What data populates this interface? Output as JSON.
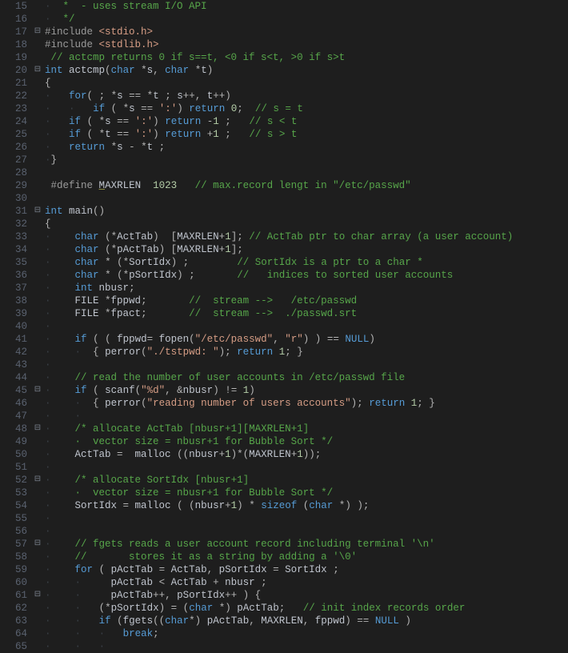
{
  "editor": {
    "first_line": 15,
    "fold_markers": {
      "20": "⊟",
      "29": " ",
      "31": "⊟",
      "45": "⊟",
      "48": "⊟",
      "52": "⊟",
      "57": "⊟",
      "61": "⊟",
      "18": " ",
      "17": "⊟"
    },
    "lines": [
      {
        "n": 15,
        "html": "<span class='guide'>·</span>  <span class='c-cmt'>*  - uses stream I/O API</span>"
      },
      {
        "n": 16,
        "html": "<span class='guide'>·</span>  <span class='c-cmt'>*/</span>"
      },
      {
        "n": 17,
        "html": "<span class='c-pp'>#include</span> <span class='c-str'>&lt;stdio.h&gt;</span>"
      },
      {
        "n": 18,
        "html": "<span class='c-pp'>#include</span> <span class='c-str'>&lt;stdlib.h&gt;</span>"
      },
      {
        "n": 19,
        "html": " <span class='c-cmt'>// actcmp returns 0 if s==t, &lt;0 if s&lt;t, &gt;0 if s&gt;t</span>"
      },
      {
        "n": 20,
        "html": "<span class='c-kw'>int</span> <span class='c-fn'>actcmp</span><span class='c-punc'>(</span><span class='c-kw'>char</span> <span class='c-op'>*</span>s<span class='c-punc'>,</span> <span class='c-kw'>char</span> <span class='c-op'>*</span>t<span class='c-punc'>)</span>"
      },
      {
        "n": 21,
        "html": "<span class='c-br'>{</span>"
      },
      {
        "n": 22,
        "html": "<span class='guide'>·</span>   <span class='c-kw'>for</span><span class='c-punc'>(</span> <span class='c-punc'>;</span> <span class='c-op'>*</span>s <span class='c-op'>==</span> <span class='c-op'>*</span>t <span class='c-punc'>;</span> s<span class='c-op'>++</span><span class='c-punc'>,</span> t<span class='c-op'>++</span><span class='c-punc'>)</span>"
      },
      {
        "n": 23,
        "html": "<span class='guide'>·</span>   <span class='guide'>·</span>   <span class='c-kw'>if</span> <span class='c-punc'>(</span> <span class='c-op'>*</span>s <span class='c-op'>==</span> <span class='c-str'>':'</span><span class='c-punc'>)</span> <span class='c-kw'>return</span> <span class='c-num'>0</span><span class='c-punc'>;</span>  <span class='c-cmt'>// s = t</span>"
      },
      {
        "n": 24,
        "html": "<span class='guide'>·</span>   <span class='c-kw'>if</span> <span class='c-punc'>(</span> <span class='c-op'>*</span>s <span class='c-op'>==</span> <span class='c-str'>':'</span><span class='c-punc'>)</span> <span class='c-kw'>return</span> <span class='c-op'>-</span><span class='c-num'>1</span> <span class='c-punc'>;</span>   <span class='c-cmt'>// s &lt; t</span>"
      },
      {
        "n": 25,
        "html": "<span class='guide'>·</span>   <span class='c-kw'>if</span> <span class='c-punc'>(</span> <span class='c-op'>*</span>t <span class='c-op'>==</span> <span class='c-str'>':'</span><span class='c-punc'>)</span> <span class='c-kw'>return</span> <span class='c-op'>+</span><span class='c-num'>1</span> <span class='c-punc'>;</span>   <span class='c-cmt'>// s &gt; t</span>"
      },
      {
        "n": 26,
        "html": "<span class='guide'>·</span>   <span class='c-kw'>return</span> <span class='c-op'>*</span>s <span class='c-op'>-</span> <span class='c-op'>*</span>t <span class='c-punc'>;</span>"
      },
      {
        "n": 27,
        "html": "<span class='guide'>·</span><span class='c-br'>}</span>"
      },
      {
        "n": 28,
        "html": ""
      },
      {
        "n": 29,
        "html": " <span class='c-pp'>#define</span> <span class='underline'>M</span>AXRLEN  <span class='c-num'>1023</span>   <span class='c-cmt'>// max.record lengt in \"/etc/passwd\"</span>"
      },
      {
        "n": 30,
        "html": ""
      },
      {
        "n": 31,
        "html": "<span class='c-kw'>int</span> <span class='c-fn'>main</span><span class='c-punc'>()</span>"
      },
      {
        "n": 32,
        "html": "<span class='c-br'>{</span>"
      },
      {
        "n": 33,
        "html": "<span class='guide'>·</span>    <span class='c-kw'>char</span> <span class='c-punc'>(</span><span class='c-op'>*</span>ActTab<span class='c-punc'>)</span>  <span class='c-punc'>[</span>MAXRLEN<span class='c-op'>+</span><span class='c-num'>1</span><span class='c-punc'>];</span> <span class='c-cmt'>// ActTab ptr to char array (a user account)</span>"
      },
      {
        "n": 34,
        "html": "<span class='guide'>·</span>    <span class='c-kw'>char</span> <span class='c-punc'>(</span><span class='c-op'>*</span>pActTab<span class='c-punc'>)</span> <span class='c-punc'>[</span>MAXRLEN<span class='c-op'>+</span><span class='c-num'>1</span><span class='c-punc'>];</span>"
      },
      {
        "n": 35,
        "html": "<span class='guide'>·</span>    <span class='c-kw'>char</span> <span class='c-op'>*</span> <span class='c-punc'>(</span><span class='c-op'>*</span>SortIdx<span class='c-punc'>)</span> <span class='c-punc'>;</span>        <span class='c-cmt'>// SortIdx is a ptr to a char *</span>"
      },
      {
        "n": 36,
        "html": "<span class='guide'>·</span>    <span class='c-kw'>char</span> <span class='c-op'>*</span> <span class='c-punc'>(</span><span class='c-op'>*</span>pSortIdx<span class='c-punc'>)</span> <span class='c-punc'>;</span>       <span class='c-cmt'>//   indices to sorted user accounts</span>"
      },
      {
        "n": 37,
        "html": "<span class='guide'>·</span>    <span class='c-kw'>int</span> nbusr<span class='c-punc'>;</span>"
      },
      {
        "n": 38,
        "html": "<span class='guide'>·</span>    FILE <span class='c-op'>*</span>fppwd<span class='c-punc'>;</span>       <span class='c-cmt'>//  stream --&gt;   /etc/passwd</span>"
      },
      {
        "n": 39,
        "html": "<span class='guide'>·</span>    FILE <span class='c-op'>*</span>fpact<span class='c-punc'>;</span>       <span class='c-cmt'>//  stream --&gt;  ./passwd.srt</span>"
      },
      {
        "n": 40,
        "html": "<span class='guide'>·</span>"
      },
      {
        "n": 41,
        "html": "<span class='guide'>·</span>    <span class='c-kw'>if</span> <span class='c-punc'>(</span> <span class='c-punc'>(</span> fppwd<span class='c-op'>=</span> fopen<span class='c-punc'>(</span><span class='c-str'>\"/etc/passwd\"</span><span class='c-punc'>,</span> <span class='c-str'>\"r\"</span><span class='c-punc'>)</span> <span class='c-punc'>)</span> <span class='c-op'>==</span> <span class='c-null'>NULL</span><span class='c-punc'>)</span>"
      },
      {
        "n": 42,
        "html": "<span class='guide'>·</span>    <span class='guide'>·</span>  <span class='c-br'>{</span> perror<span class='c-punc'>(</span><span class='c-str'>\"./tstpwd: \"</span><span class='c-punc'>);</span> <span class='c-kw'>return</span> <span class='c-num'>1</span><span class='c-punc'>;</span> <span class='c-br'>}</span>"
      },
      {
        "n": 43,
        "html": "<span class='guide'>·</span>"
      },
      {
        "n": 44,
        "html": "<span class='guide'>·</span>    <span class='c-cmt'>// read the number of user accounts in /etc/passwd file</span>"
      },
      {
        "n": 45,
        "html": "<span class='guide'>·</span>    <span class='c-kw'>if</span> <span class='c-punc'>(</span> scanf<span class='c-punc'>(</span><span class='c-str'>\"%d\"</span><span class='c-punc'>,</span> <span class='c-op'>&amp;</span>nbusr<span class='c-punc'>)</span> <span class='c-op'>!=</span> <span class='c-num'>1</span><span class='c-punc'>)</span>"
      },
      {
        "n": 46,
        "html": "<span class='guide'>·</span>    <span class='guide'>·</span>  <span class='c-br'>{</span> perror<span class='c-punc'>(</span><span class='c-str'>\"reading number of users accounts\"</span><span class='c-punc'>);</span> <span class='c-kw'>return</span> <span class='c-num'>1</span><span class='c-punc'>;</span> <span class='c-br'>}</span>"
      },
      {
        "n": 47,
        "html": "<span class='guide'>·</span>    <span class='guide'>·</span>"
      },
      {
        "n": 48,
        "html": "<span class='guide'>·</span>    <span class='c-cmt'>/* allocate ActTab [nbusr+1][MAXRLEN+1]</span>"
      },
      {
        "n": 49,
        "html": "<span class='guide'>·</span>    <span class='c-cmt'>·  vector size = nbusr+1 for Bubble Sort */</span>"
      },
      {
        "n": 50,
        "html": "<span class='guide'>·</span>    ActTab <span class='c-op'>=</span>  malloc <span class='c-punc'>((</span>nbusr<span class='c-op'>+</span><span class='c-num'>1</span><span class='c-punc'>)</span><span class='c-op'>*</span><span class='c-punc'>(</span>MAXRLEN<span class='c-op'>+</span><span class='c-num'>1</span><span class='c-punc'>));</span>"
      },
      {
        "n": 51,
        "html": "<span class='guide'>·</span>"
      },
      {
        "n": 52,
        "html": "<span class='guide'>·</span>    <span class='c-cmt'>/* allocate SortIdx [nbusr+1]</span>"
      },
      {
        "n": 53,
        "html": "<span class='guide'>·</span>    <span class='c-cmt'>·  vector size = nbusr+1 for Bubble Sort */</span>"
      },
      {
        "n": 54,
        "html": "<span class='guide'>·</span>    SortIdx <span class='c-op'>=</span> malloc <span class='c-punc'>(</span> <span class='c-punc'>(</span>nbusr<span class='c-op'>+</span><span class='c-num'>1</span><span class='c-punc'>)</span> <span class='c-op'>*</span> <span class='c-kw'>sizeof</span> <span class='c-punc'>(</span><span class='c-kw'>char</span> <span class='c-op'>*</span><span class='c-punc'>)</span> <span class='c-punc'>);</span>"
      },
      {
        "n": 55,
        "html": "<span class='guide'>·</span>"
      },
      {
        "n": 56,
        "html": "<span class='guide'>·</span>"
      },
      {
        "n": 57,
        "html": "<span class='guide'>·</span>    <span class='c-cmt'>// fgets reads a user account record including terminal '\\n'</span>"
      },
      {
        "n": 58,
        "html": "<span class='guide'>·</span>    <span class='c-cmt'>//       stores it as a string by adding a '\\0'</span>"
      },
      {
        "n": 59,
        "html": "<span class='guide'>·</span>    <span class='c-kw'>for</span> <span class='c-punc'>(</span> pActTab <span class='c-op'>=</span> ActTab<span class='c-punc'>,</span> pSortIdx <span class='c-op'>=</span> SortIdx <span class='c-punc'>;</span>"
      },
      {
        "n": 60,
        "html": "<span class='guide'>·</span>    <span class='guide'>·</span>     pActTab <span class='c-op'>&lt;</span> ActTab <span class='c-op'>+</span> nbusr <span class='c-punc'>;</span>"
      },
      {
        "n": 61,
        "html": "<span class='guide'>·</span>    <span class='guide'>·</span>     pActTab<span class='c-op'>++</span><span class='c-punc'>,</span> pSortIdx<span class='c-op'>++</span> <span class='c-punc'>)</span> <span class='c-br'>{</span>"
      },
      {
        "n": 62,
        "html": "<span class='guide'>·</span>    <span class='guide'>·</span>   <span class='c-punc'>(</span><span class='c-op'>*</span>pSortIdx<span class='c-punc'>)</span> <span class='c-op'>=</span> <span class='c-punc'>(</span><span class='c-kw'>char</span> <span class='c-op'>*</span><span class='c-punc'>)</span> pActTab<span class='c-punc'>;</span>   <span class='c-cmt'>// init index records order</span>"
      },
      {
        "n": 63,
        "html": "<span class='guide'>·</span>    <span class='guide'>·</span>   <span class='c-kw'>if</span> <span class='c-punc'>(</span>fgets<span class='c-punc'>((</span><span class='c-kw'>char</span><span class='c-op'>*</span><span class='c-punc'>)</span> pActTab<span class='c-punc'>,</span> MAXRLEN<span class='c-punc'>,</span> fppwd<span class='c-punc'>)</span> <span class='c-op'>==</span> <span class='c-null'>NULL</span> <span class='c-punc'>)</span>"
      },
      {
        "n": 64,
        "html": "<span class='guide'>·</span>    <span class='guide'>·</span>   <span class='guide'>·</span>   <span class='c-kw'>break</span><span class='c-punc'>;</span>"
      },
      {
        "n": 65,
        "html": "<span class='guide'>·</span>    <span class='guide'>·</span>   <span class='guide'>·</span>"
      }
    ]
  }
}
